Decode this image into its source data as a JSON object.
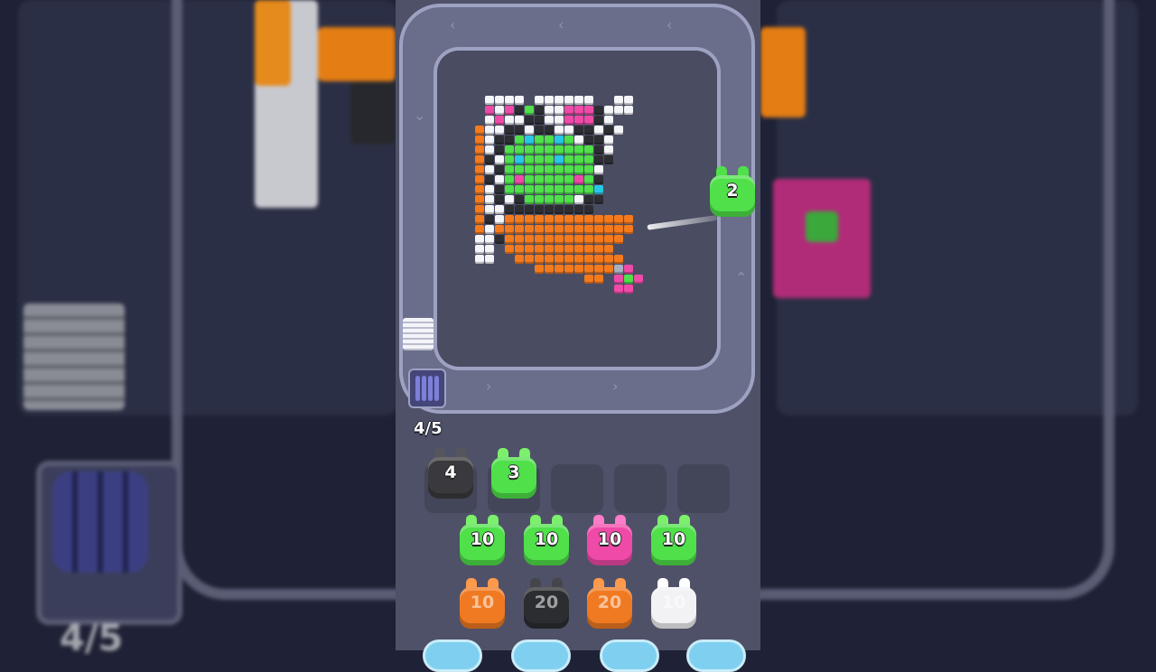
{
  "game": {
    "progress_counter": "4/5",
    "background_counter": "4/5"
  },
  "shooter": {
    "count": "2",
    "color": "#4fe04a"
  },
  "held_slots": [
    {
      "count": "4",
      "color": "#3a3a3e",
      "ear": "#55565c"
    },
    {
      "count": "3",
      "color": "#4fe04a",
      "ear": "#7cf06c"
    }
  ],
  "empty_slot_count": 3,
  "queue_rows": [
    [
      {
        "count": "10",
        "color": "#4fe04a",
        "ear": "#7cf06c",
        "dim": false
      },
      {
        "count": "10",
        "color": "#4fe04a",
        "ear": "#7cf06c",
        "dim": false
      },
      {
        "count": "10",
        "color": "#f04aa8",
        "ear": "#ff7cc8",
        "dim": false
      },
      {
        "count": "10",
        "color": "#4fe04a",
        "ear": "#7cf06c",
        "dim": false
      }
    ],
    [
      {
        "count": "10",
        "color": "#f07a22",
        "ear": "#ff9a4a",
        "dim": true
      },
      {
        "count": "20",
        "color": "#2c2d31",
        "ear": "#45464c",
        "dim": true
      },
      {
        "count": "20",
        "color": "#f07a22",
        "ear": "#ff9a4a",
        "dim": true
      },
      {
        "count": "10",
        "color": "#f2f2f5",
        "ear": "#ffffff",
        "dim": true
      }
    ]
  ],
  "palette": {
    "W": "#f4f5f8",
    "K": "#2d2e33",
    "G": "#4fe04a",
    "C": "#27c8e6",
    "P": "#f04aa8",
    "O": "#f47a1c",
    "E": "#a8b1bd"
  },
  "pixel_art_rows": [
    ".WWWW.WWWWWW..WW",
    ".PWPKGKWWPPPKWWW",
    ".WPWWKKWWPPPKW..",
    "OWWKKWKKWWKKWKW.",
    "OWKKGCGGCGWKKW..",
    "OWKGGGGGGGGGKW..",
    "OKWGCGGGCGGGKK..",
    "OWKGGGGGGGGGW...",
    "OKWGPGGGGGPGK...",
    "OWKGGGGGGGGGC...",
    "OWKWKGGGGGWKK...",
    "OWWKKKKKKKKK....",
    "OKWOOOOOOOOOOOOO",
    "OWOOOOOOOOOOOOOO",
    "WWKOOOOOOOOOOOO.",
    "WW.OOOOOOOOOOO..",
    "WW..OOOOOOOOOOO.",
    "......OOOOOOOOEP",
    "...........OO.PGP",
    "..............PP."
  ]
}
